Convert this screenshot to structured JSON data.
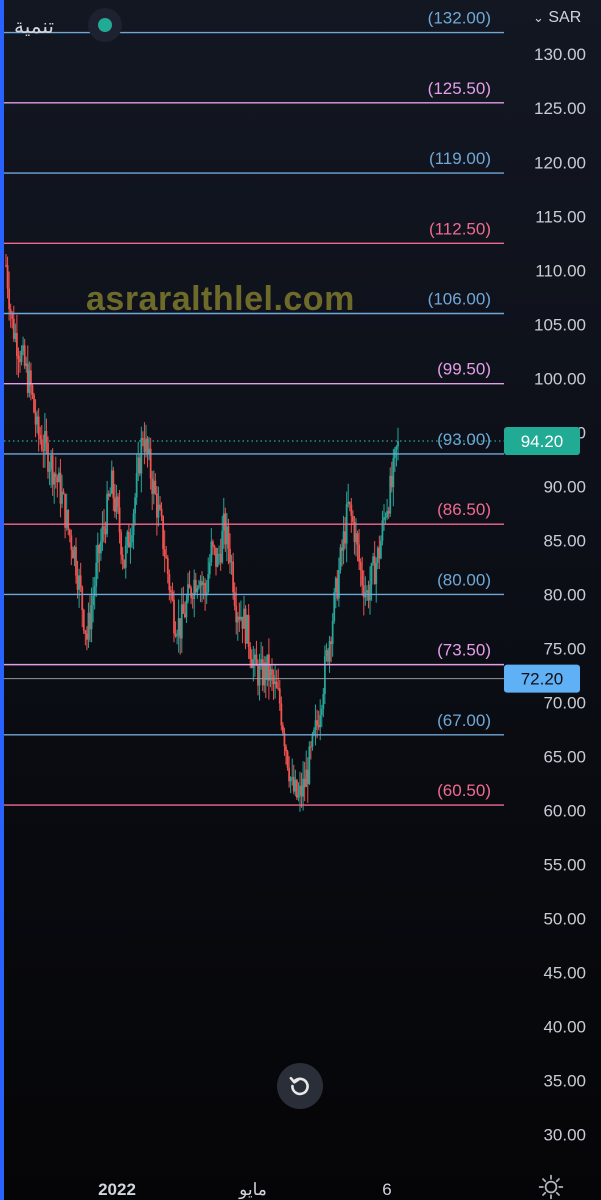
{
  "header": {
    "symbol": "تنمية",
    "currency": "SAR",
    "status_color": "#22ab94",
    "status_icon": "market-status-dot-icon",
    "currency_icon": "chevron-down-icon"
  },
  "watermark": "asraralthlel.com",
  "price_axis": {
    "ticks": [
      "130.00",
      "125.00",
      "120.00",
      "115.00",
      "110.00",
      "105.00",
      "100.00",
      "95.00",
      "90.00",
      "85.00",
      "80.00",
      "75.00",
      "70.00",
      "65.00",
      "60.00",
      "55.00",
      "50.00",
      "45.00",
      "40.00",
      "35.00",
      "30.00"
    ]
  },
  "time_axis": {
    "labels": [
      "2022",
      "مايو",
      "6"
    ]
  },
  "current_price": {
    "label": "94.20",
    "color": "#22ab94"
  },
  "crosshair_price": {
    "label": "72.20",
    "color": "#5fb0f5"
  },
  "controls": {
    "reset_icon": "reset-scale-icon",
    "settings_icon": "settings-sun-icon"
  },
  "chart_data": {
    "type": "candlestick",
    "currency": "SAR",
    "y_range": [
      27,
      134
    ],
    "y_ticks": [
      130,
      125,
      120,
      115,
      110,
      105,
      100,
      95,
      90,
      85,
      80,
      75,
      70,
      65,
      60,
      55,
      50,
      45,
      40,
      35,
      30
    ],
    "x_labels": [
      "2022",
      "مايو",
      "6"
    ],
    "last_price": 94.2,
    "crosshair_price": 72.2,
    "levels": [
      {
        "value": 132.0,
        "label": "(132.00)",
        "color": "#6fa8d6"
      },
      {
        "value": 125.5,
        "label": "(125.50)",
        "color": "#e39ee8"
      },
      {
        "value": 119.0,
        "label": "(119.00)",
        "color": "#6fa8d6"
      },
      {
        "value": 112.5,
        "label": "(112.50)",
        "color": "#f06a8f"
      },
      {
        "value": 106.0,
        "label": "(106.00)",
        "color": "#6fa8d6"
      },
      {
        "value": 99.5,
        "label": "(99.50)",
        "color": "#e39ee8"
      },
      {
        "value": 93.0,
        "label": "(93.00)",
        "color": "#6fa8d6"
      },
      {
        "value": 86.5,
        "label": "(86.50)",
        "color": "#f06a8f"
      },
      {
        "value": 80.0,
        "label": "(80.00)",
        "color": "#6fa8d6"
      },
      {
        "value": 73.5,
        "label": "(73.50)",
        "color": "#e39ee8"
      },
      {
        "value": 67.0,
        "label": "(67.00)",
        "color": "#6fa8d6"
      },
      {
        "value": 60.5,
        "label": "(60.50)",
        "color": "#f06a8f"
      }
    ],
    "path": [
      [
        0,
        110.5
      ],
      [
        4,
        105
      ],
      [
        8,
        103
      ],
      [
        12,
        101
      ],
      [
        16,
        99
      ],
      [
        20,
        95
      ],
      [
        24,
        94
      ],
      [
        28,
        92.5
      ],
      [
        32,
        91
      ],
      [
        36,
        89
      ],
      [
        40,
        86
      ],
      [
        44,
        84
      ],
      [
        48,
        80
      ],
      [
        52,
        76
      ],
      [
        56,
        80
      ],
      [
        60,
        84
      ],
      [
        64,
        87
      ],
      [
        68,
        90
      ],
      [
        72,
        87
      ],
      [
        76,
        83
      ],
      [
        80,
        86
      ],
      [
        84,
        90
      ],
      [
        88,
        95
      ],
      [
        92,
        92
      ],
      [
        96,
        89
      ],
      [
        100,
        86
      ],
      [
        104,
        82
      ],
      [
        108,
        78
      ],
      [
        112,
        77
      ],
      [
        116,
        79
      ],
      [
        120,
        81
      ],
      [
        124,
        82
      ],
      [
        128,
        80
      ],
      [
        132,
        84
      ],
      [
        136,
        83
      ],
      [
        140,
        86
      ],
      [
        144,
        84
      ],
      [
        148,
        79
      ],
      [
        152,
        78
      ],
      [
        156,
        76
      ],
      [
        160,
        73
      ],
      [
        164,
        72.5
      ],
      [
        168,
        73
      ],
      [
        172,
        71.5
      ],
      [
        176,
        70
      ],
      [
        180,
        66
      ],
      [
        184,
        62
      ],
      [
        188,
        61
      ],
      [
        192,
        62.5
      ],
      [
        196,
        65
      ],
      [
        200,
        68
      ],
      [
        204,
        72
      ],
      [
        208,
        76
      ],
      [
        212,
        80
      ],
      [
        216,
        84
      ],
      [
        220,
        88
      ],
      [
        224,
        86
      ],
      [
        228,
        82
      ],
      [
        232,
        80
      ],
      [
        236,
        82
      ],
      [
        240,
        84
      ],
      [
        244,
        88
      ],
      [
        248,
        90
      ],
      [
        252,
        94.2
      ]
    ],
    "colors": {
      "up": "#26a69a",
      "down": "#ef5350",
      "grid": "none"
    }
  }
}
